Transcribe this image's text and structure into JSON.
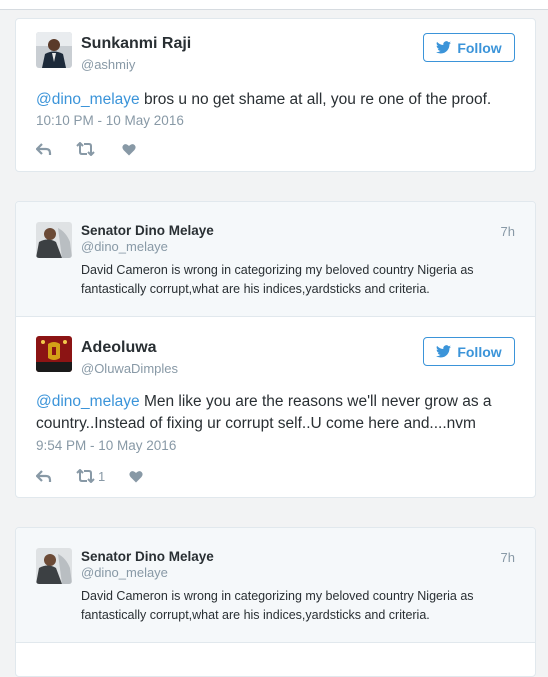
{
  "colors": {
    "link": "#3b94d9",
    "muted": "#8899a6",
    "text": "#292f33",
    "border": "#e1e8ed"
  },
  "tweets": [
    {
      "author": {
        "name": "Sunkanmi Raji",
        "handle": "@ashmiy"
      },
      "follow_label": "Follow",
      "mention": "@dino_melaye",
      "text": " bros u no get shame at all, you re one of the proof.",
      "date": "10:10 PM - 10 May 2016",
      "retweet_count": "",
      "icons": [
        "reply-icon",
        "retweet-icon",
        "like-icon"
      ]
    },
    {
      "quoted": {
        "name": "Senator Dino Melaye",
        "handle": "@dino_melaye",
        "time": "7h",
        "text": "David Cameron is wrong in categorizing my beloved country Nigeria as fantastically corrupt,what are his indices,yardsticks and criteria."
      },
      "author": {
        "name": "Adeoluwa",
        "handle": "@OluwaDimples"
      },
      "follow_label": "Follow",
      "mention": "@dino_melaye",
      "text": " Men like you are the reasons we'll never grow as a country..Instead of fixing ur corrupt self..U come here and....nvm",
      "date": "9:54 PM - 10 May 2016",
      "retweet_count": "1",
      "icons": [
        "reply-icon",
        "retweet-icon",
        "like-icon"
      ]
    },
    {
      "quoted": {
        "name": "Senator Dino Melaye",
        "handle": "@dino_melaye",
        "time": "7h",
        "text": "David Cameron is wrong in categorizing my beloved country Nigeria as fantastically corrupt,what are his indices,yardsticks and criteria."
      }
    }
  ]
}
